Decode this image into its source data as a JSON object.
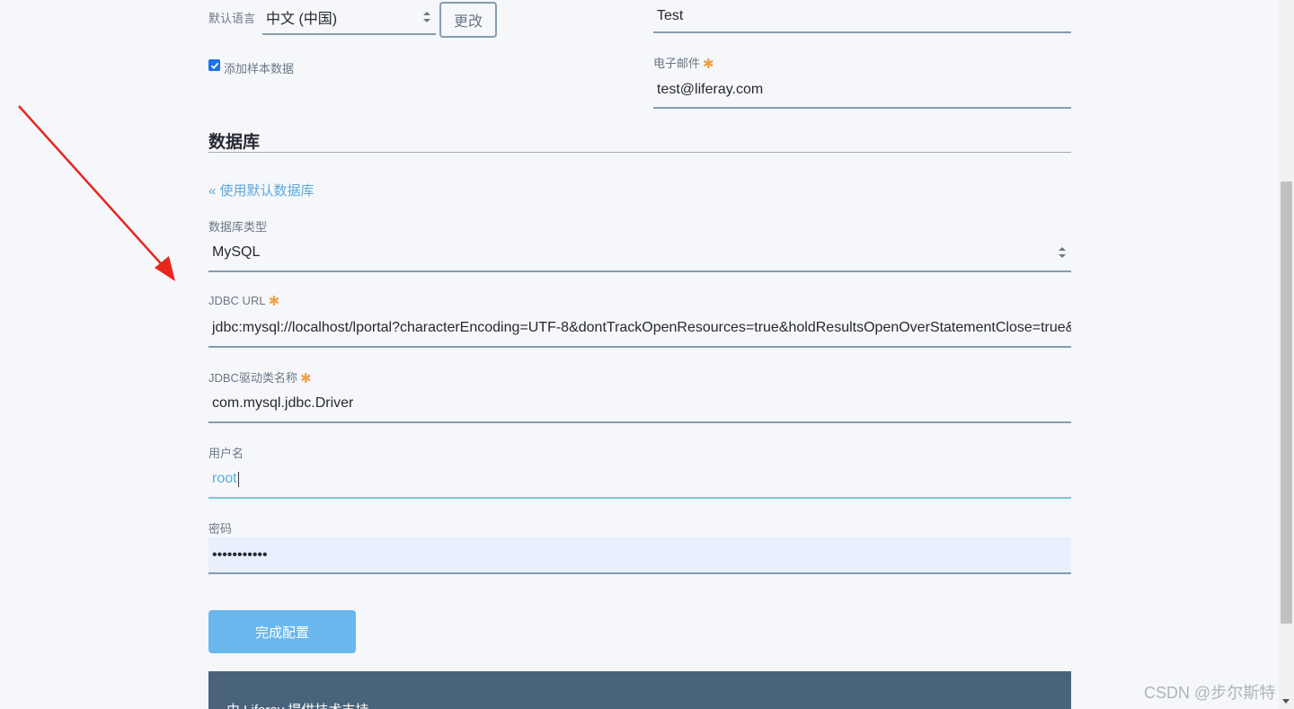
{
  "language": {
    "label": "默认语言",
    "selected": "中文 (中国)",
    "change_button": "更改"
  },
  "admin": {
    "last_name_value": "Test",
    "email_label": "电子邮件",
    "email_value": "test@liferay.com",
    "required_mark": "✱"
  },
  "sample_data": {
    "label": "添加样本数据",
    "checked": true
  },
  "database": {
    "section_title": "数据库",
    "use_default_link": "« 使用默认数据库",
    "type_label": "数据库类型",
    "type_value": "MySQL",
    "jdbc_url_label": "JDBC URL",
    "jdbc_url_value": "jdbc:mysql://localhost/lportal?characterEncoding=UTF-8&dontTrackOpenResources=true&holdResultsOpenOverStatementClose=true&",
    "driver_label": "JDBC驱动类名称",
    "driver_value": "com.mysql.jdbc.Driver",
    "username_label": "用户名",
    "username_value": "root",
    "password_label": "密码",
    "password_value": "•••••••••••"
  },
  "submit_button": "完成配置",
  "footer": {
    "text": "由 Liferay 提供技术支持"
  },
  "watermark": "CSDN @步尔斯特",
  "colors": {
    "background": "#f5f7fa",
    "input_border": "#869cad",
    "submit": "#6ab7ee",
    "footer": "#48637a",
    "required": "#f0a04b",
    "link": "#5fa8d9",
    "annotation_arrow": "#e8261e"
  }
}
